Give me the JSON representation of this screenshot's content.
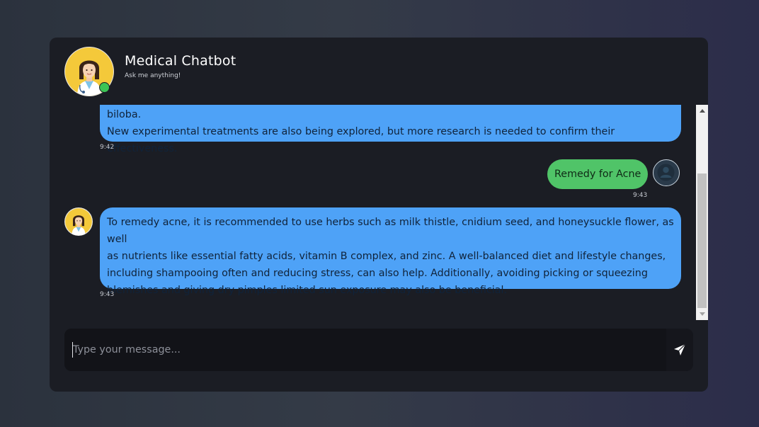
{
  "header": {
    "title": "Medical Chatbot",
    "subtitle": "Ask me anything!",
    "avatar_icon": "doctor-avatar-icon",
    "status_icon": "online-status-dot",
    "status_color": "#3cc455"
  },
  "messages": [
    {
      "sender": "bot",
      "lines": [
        "researched for reducing the risk of developing the disease include estrogen, NSAIDs, vitamin E, and ginkgo biloba.",
        "New experimental treatments are also being explored, but more research is needed to confirm their effectiveness."
      ],
      "time": "9:42"
    },
    {
      "sender": "user",
      "text": "Remedy for Acne",
      "time": "9:43"
    },
    {
      "sender": "bot",
      "lines": [
        "To remedy acne, it is recommended to use herbs such as milk thistle, cnidium seed, and honeysuckle flower, as well",
        "as nutrients like essential fatty acids, vitamin B complex, and zinc. A well-balanced diet and lifestyle changes,",
        "including shampooing often and reducing stress, can also help. Additionally, avoiding picking or squeezing",
        "blemishes and giving dry pimples limited sun exposure may also be beneficial."
      ],
      "time": "9:43"
    }
  ],
  "composer": {
    "placeholder": "Type your message...",
    "value": "",
    "send_icon": "send-icon"
  },
  "colors": {
    "bot_bubble": "#4ea2f7",
    "user_bubble": "#50c468",
    "card_background": "#1b1d24"
  }
}
